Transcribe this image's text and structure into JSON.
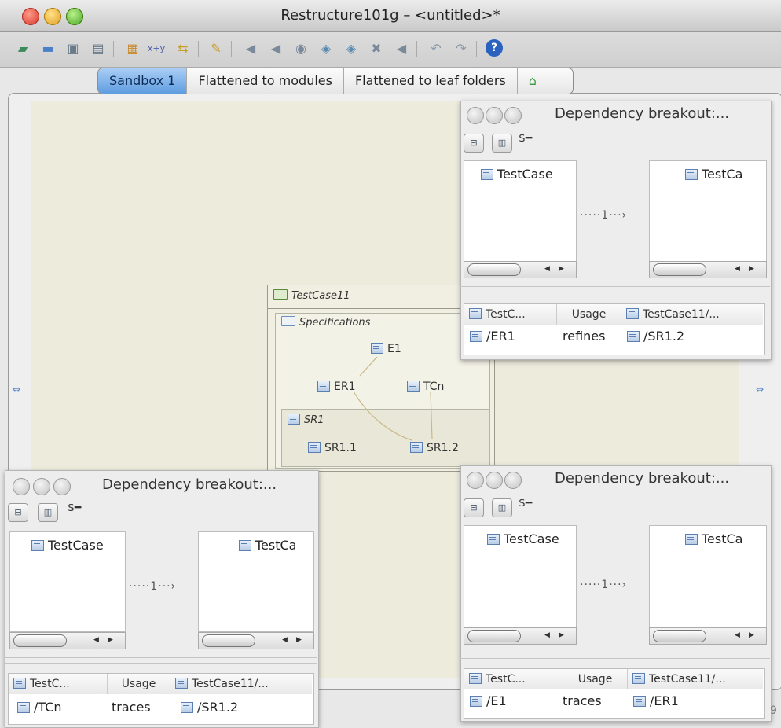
{
  "window": {
    "title": "Restructure101g – <untitled>*"
  },
  "toolbar": {
    "icons": [
      "new-icon",
      "open-icon",
      "save-icon",
      "save-as-icon",
      "paste-icon",
      "xy-icon",
      "swap-icon",
      "pin-icon",
      "back-arrow-icon",
      "forward-arrow-icon",
      "zoom-icon",
      "zoom-in-icon",
      "zoom-out-icon",
      "expand-icon",
      "collapse-icon",
      "undo-icon",
      "redo-icon",
      "help-icon"
    ],
    "xy_label": "x+y"
  },
  "tabs": [
    {
      "label": "Sandbox 1",
      "active": true
    },
    {
      "label": "Flattened to modules",
      "active": false
    },
    {
      "label": "Flattened to leaf folders",
      "active": false
    }
  ],
  "diagram": {
    "package": "TestCase11",
    "folder": "Specifications",
    "nodes": {
      "e1": "E1",
      "er1": "ER1",
      "tcn": "TCn"
    },
    "subpackage": "SR1",
    "subnodes": {
      "sr11": "SR1.1",
      "sr12": "SR1.2"
    }
  },
  "dep_windows": [
    {
      "title": "Dependency breakout:...",
      "left_pane": "TestCase",
      "right_pane": "TestCa",
      "edge_label": "1",
      "columns": [
        "TestC...",
        "Usage",
        "TestCase11/..."
      ],
      "row": {
        "from": "/ER1",
        "usage": "refines",
        "to": "/SR1.2"
      }
    },
    {
      "title": "Dependency breakout:...",
      "left_pane": "TestCase",
      "right_pane": "TestCa",
      "edge_label": "1",
      "columns": [
        "TestC...",
        "Usage",
        "TestCase11/..."
      ],
      "row": {
        "from": "/TCn",
        "usage": "traces",
        "to": "/SR1.2"
      }
    },
    {
      "title": "Dependency breakout:...",
      "left_pane": "TestCase",
      "right_pane": "TestCa",
      "edge_label": "1",
      "columns": [
        "TestC...",
        "Usage",
        "TestCase11/..."
      ],
      "row": {
        "from": "/E1",
        "usage": "traces",
        "to": "/ER1"
      }
    }
  ],
  "status_fragment": "9"
}
